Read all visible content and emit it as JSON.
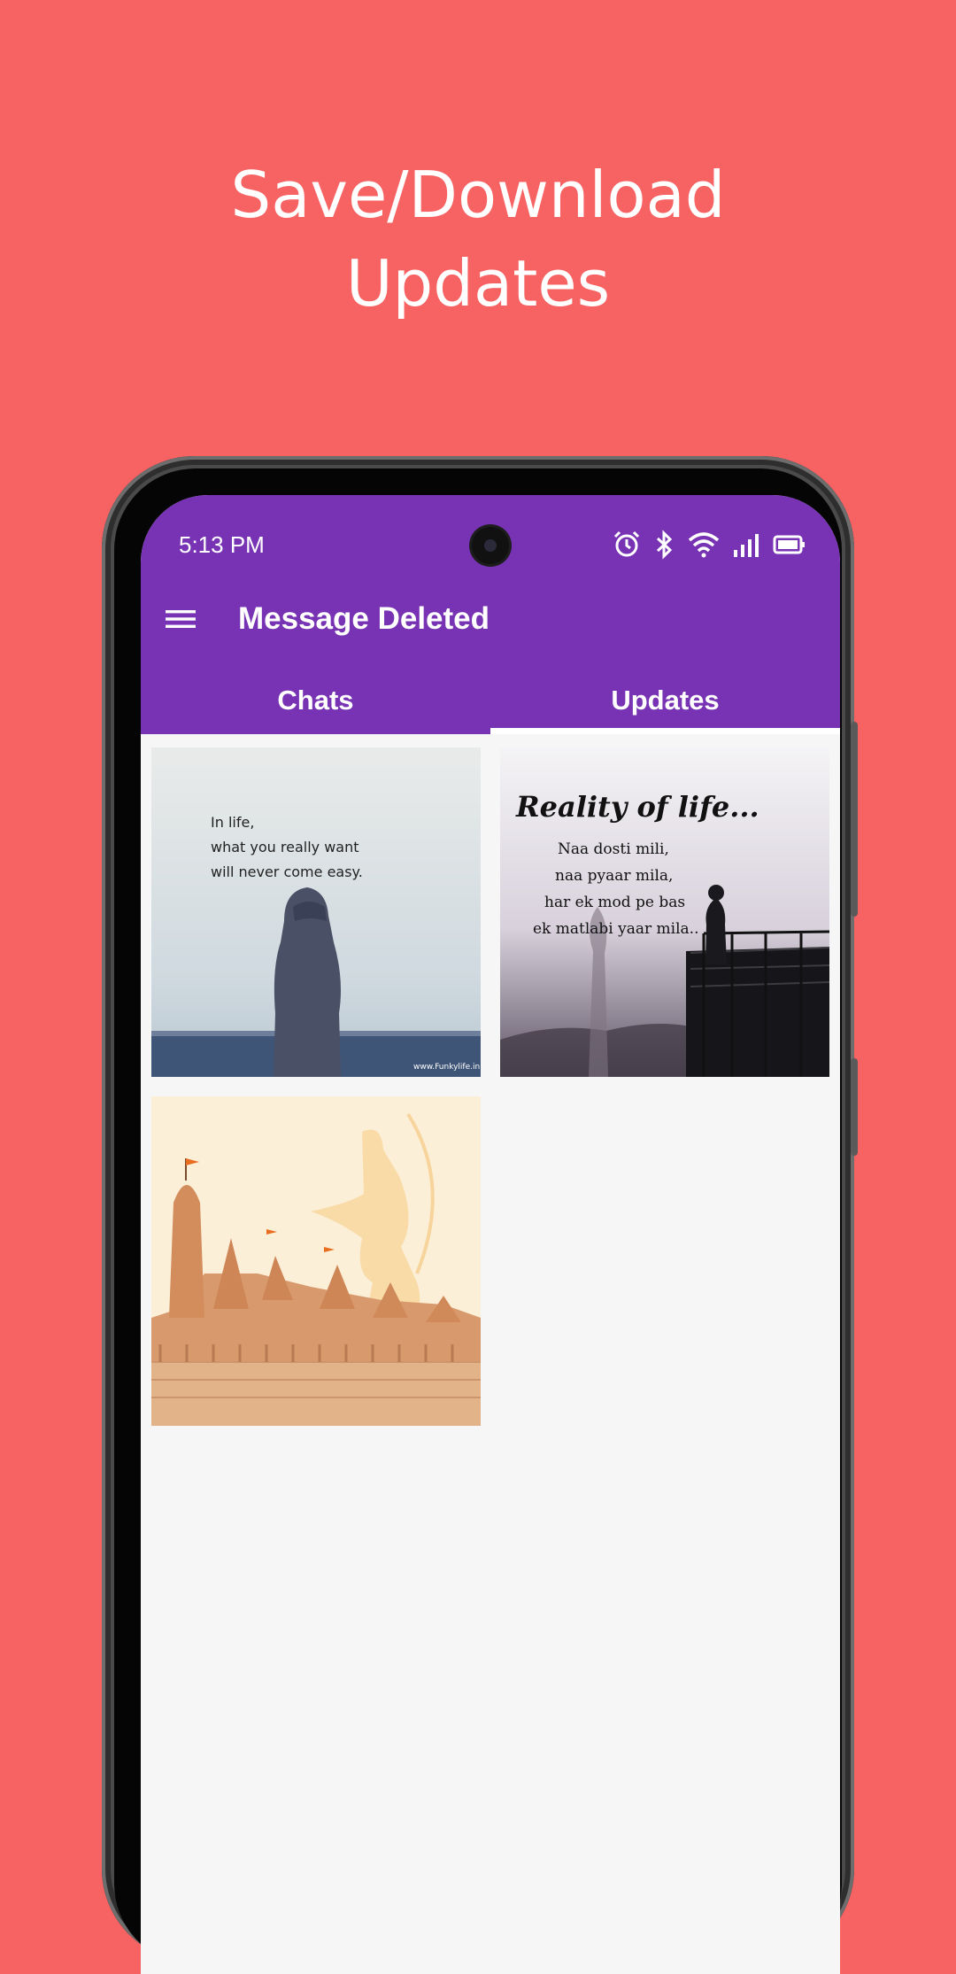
{
  "promo": {
    "headline_line1": "Save/Download",
    "headline_line2": "Updates"
  },
  "status_bar": {
    "time": "5:13 PM",
    "icons": [
      "alarm-icon",
      "bluetooth-icon",
      "wifi-icon",
      "signal-icon",
      "battery-icon"
    ]
  },
  "app": {
    "title": "Message Deleted",
    "menu_icon": "hamburger-menu-icon",
    "accent_color": "#7733b4",
    "background_color": "#f76262"
  },
  "tabs": [
    {
      "label": "Chats",
      "selected": false
    },
    {
      "label": "Updates",
      "selected": true
    }
  ],
  "updates": [
    {
      "line1": "In life,",
      "line2": "what you really want",
      "line3": "will never come easy.",
      "watermark": "www.Funkylife.in"
    },
    {
      "title": "Reality of life...",
      "line1": "Naa dosti mili,",
      "line2": "naa pyaar mila,",
      "line3": "har ek mod pe bas",
      "line4": "ek matlabi yaar mila.."
    },
    {}
  ]
}
